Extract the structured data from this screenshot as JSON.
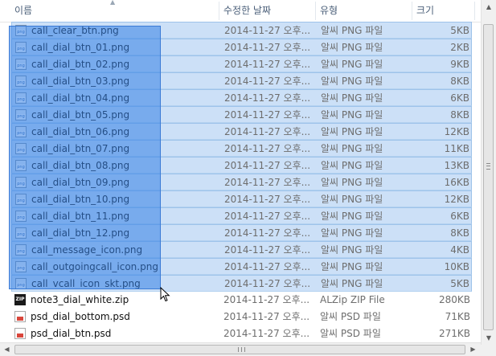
{
  "columns": {
    "name": "이름",
    "date": "수정한 날짜",
    "type": "유형",
    "size": "크기"
  },
  "sort": {
    "column": "name",
    "direction": "ascending",
    "icon": "sort-up-arrow"
  },
  "files": [
    {
      "name": "call_clear_btn.png",
      "date": "2014-11-27 오후...",
      "type": "알씨 PNG 파일",
      "size": "5KB",
      "icon": "png-file-icon",
      "selected": true
    },
    {
      "name": "call_dial_btn_01.png",
      "date": "2014-11-27 오후...",
      "type": "알씨 PNG 파일",
      "size": "2KB",
      "icon": "png-file-icon",
      "selected": true
    },
    {
      "name": "call_dial_btn_02.png",
      "date": "2014-11-27 오후...",
      "type": "알씨 PNG 파일",
      "size": "9KB",
      "icon": "png-file-icon",
      "selected": true
    },
    {
      "name": "call_dial_btn_03.png",
      "date": "2014-11-27 오후...",
      "type": "알씨 PNG 파일",
      "size": "8KB",
      "icon": "png-file-icon",
      "selected": true
    },
    {
      "name": "call_dial_btn_04.png",
      "date": "2014-11-27 오후...",
      "type": "알씨 PNG 파일",
      "size": "6KB",
      "icon": "png-file-icon",
      "selected": true
    },
    {
      "name": "call_dial_btn_05.png",
      "date": "2014-11-27 오후...",
      "type": "알씨 PNG 파일",
      "size": "8KB",
      "icon": "png-file-icon",
      "selected": true
    },
    {
      "name": "call_dial_btn_06.png",
      "date": "2014-11-27 오후...",
      "type": "알씨 PNG 파일",
      "size": "12KB",
      "icon": "png-file-icon",
      "selected": true
    },
    {
      "name": "call_dial_btn_07.png",
      "date": "2014-11-27 오후...",
      "type": "알씨 PNG 파일",
      "size": "11KB",
      "icon": "png-file-icon",
      "selected": true
    },
    {
      "name": "call_dial_btn_08.png",
      "date": "2014-11-27 오후...",
      "type": "알씨 PNG 파일",
      "size": "13KB",
      "icon": "png-file-icon",
      "selected": true
    },
    {
      "name": "call_dial_btn_09.png",
      "date": "2014-11-27 오후...",
      "type": "알씨 PNG 파일",
      "size": "16KB",
      "icon": "png-file-icon",
      "selected": true
    },
    {
      "name": "call_dial_btn_10.png",
      "date": "2014-11-27 오후...",
      "type": "알씨 PNG 파일",
      "size": "12KB",
      "icon": "png-file-icon",
      "selected": true
    },
    {
      "name": "call_dial_btn_11.png",
      "date": "2014-11-27 오후...",
      "type": "알씨 PNG 파일",
      "size": "6KB",
      "icon": "png-file-icon",
      "selected": true
    },
    {
      "name": "call_dial_btn_12.png",
      "date": "2014-11-27 오후...",
      "type": "알씨 PNG 파일",
      "size": "8KB",
      "icon": "png-file-icon",
      "selected": true
    },
    {
      "name": "call_message_icon.png",
      "date": "2014-11-27 오후...",
      "type": "알씨 PNG 파일",
      "size": "4KB",
      "icon": "png-file-icon",
      "selected": true
    },
    {
      "name": "call_outgoingcall_icon.png",
      "date": "2014-11-27 오후...",
      "type": "알씨 PNG 파일",
      "size": "10KB",
      "icon": "png-file-icon",
      "selected": true
    },
    {
      "name": "call_vcall_icon_skt.png",
      "date": "2014-11-27 오후...",
      "type": "알씨 PNG 파일",
      "size": "5KB",
      "icon": "png-file-icon",
      "selected": true
    },
    {
      "name": "note3_dial_white.zip",
      "date": "2014-11-27 오후...",
      "type": "ALZip ZIP File",
      "size": "280KB",
      "icon": "zip-file-icon",
      "selected": false
    },
    {
      "name": "psd_dial_bottom.psd",
      "date": "2014-11-27 오후...",
      "type": "알씨 PSD 파일",
      "size": "71KB",
      "icon": "psd-file-icon",
      "selected": false
    },
    {
      "name": "psd_dial_btn.psd",
      "date": "2014-11-27 오후...",
      "type": "알씨 PSD 파일",
      "size": "271KB",
      "icon": "psd-file-icon",
      "selected": false
    }
  ],
  "scrollbars": {
    "vertical_icons": [
      "scroll-up-arrow-icon",
      "scroll-down-arrow-icon"
    ],
    "horizontal_icons": [
      "scroll-left-arrow-icon",
      "scroll-right-arrow-icon"
    ]
  },
  "colors": {
    "selection_fill": "#cce0f7",
    "selection_border": "#9ec3ea",
    "marquee": "#3380e6",
    "header_text": "#4c607a",
    "secondary_text": "#6d6d6d"
  }
}
